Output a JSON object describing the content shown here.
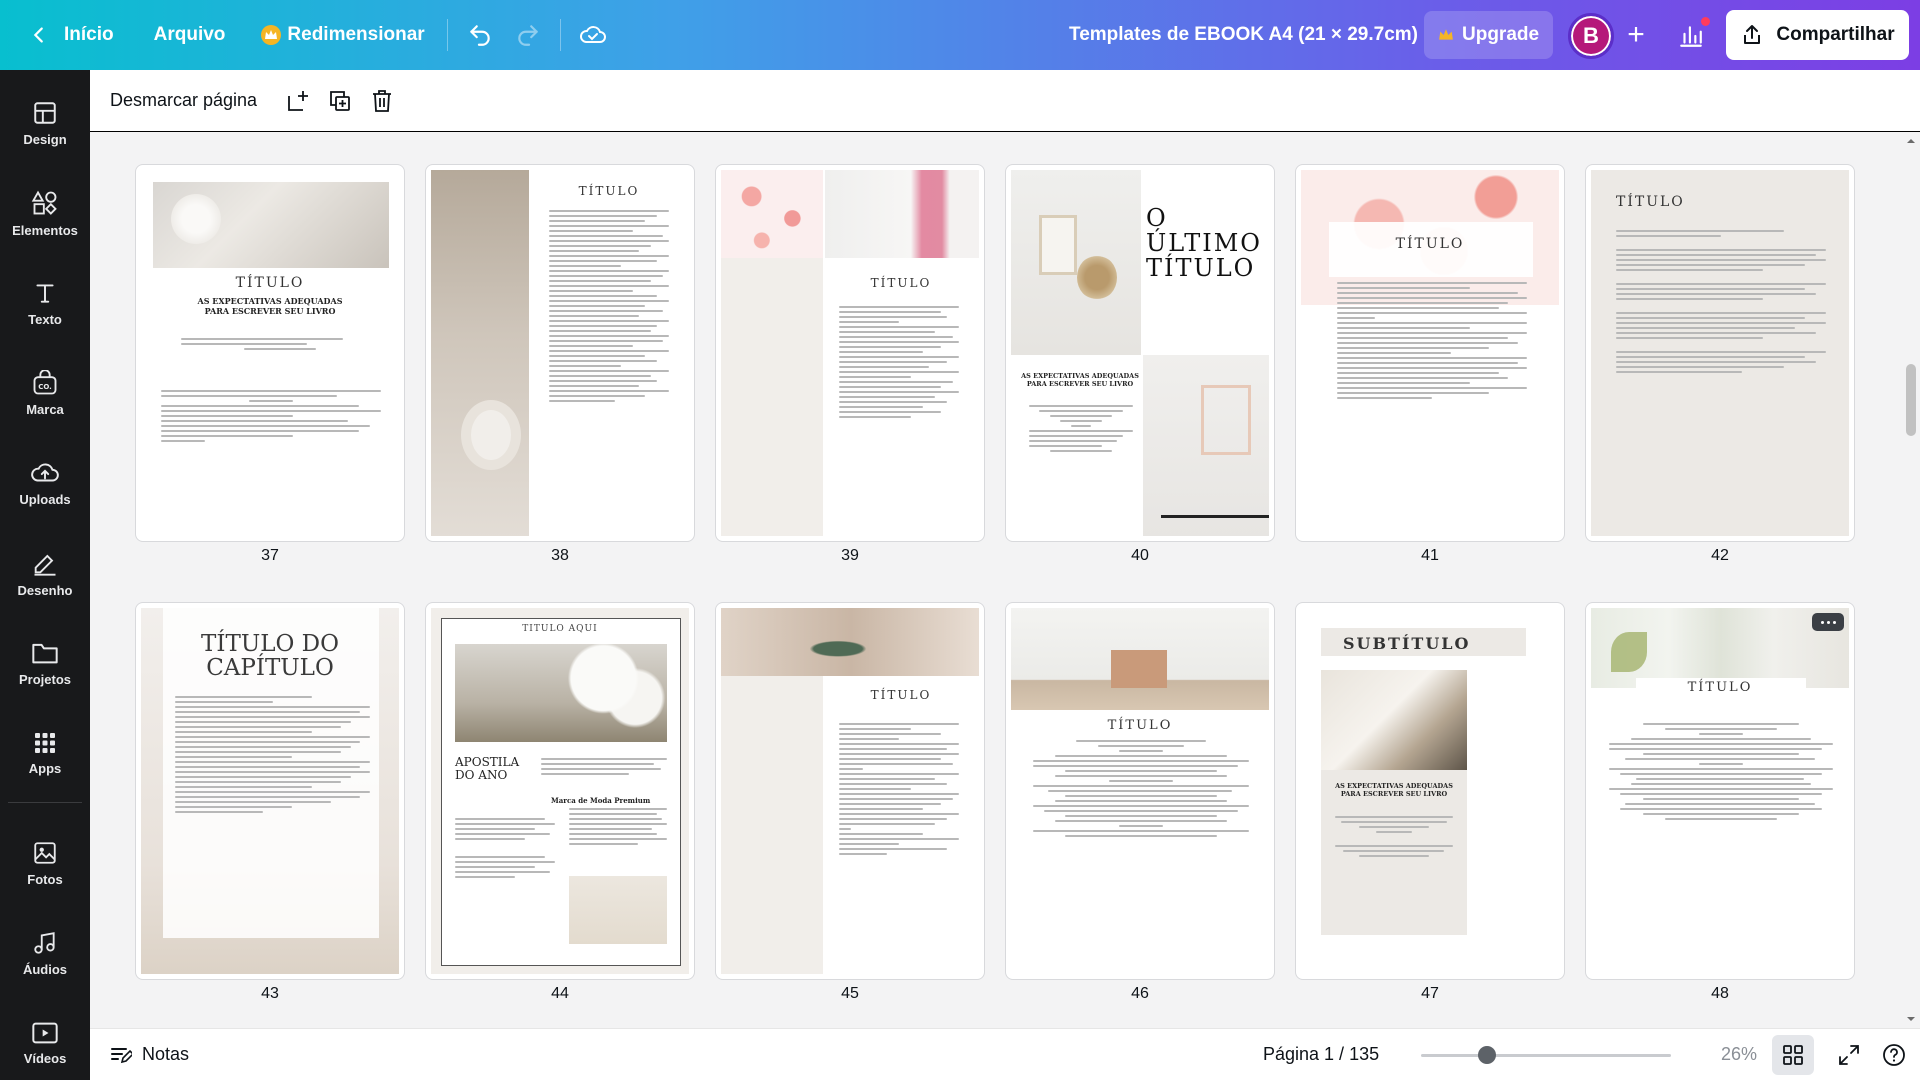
{
  "topbar": {
    "home_label": "Início",
    "file_label": "Arquivo",
    "resize_label": "Redimensionar",
    "doc_title": "Templates de EBOOK A4 (21 × 29.7cm)",
    "upgrade_label": "Upgrade",
    "avatar_initial": "B",
    "share_label": "Compartilhar",
    "accent_gradient": [
      "#08bfcf",
      "#7c3ee4"
    ]
  },
  "sidebar": {
    "items": [
      {
        "label": "Design",
        "icon": "layout-icon"
      },
      {
        "label": "Elementos",
        "icon": "shapes-icon"
      },
      {
        "label": "Texto",
        "icon": "text-icon"
      },
      {
        "label": "Marca",
        "icon": "brand-icon"
      },
      {
        "label": "Uploads",
        "icon": "cloud-upload-icon"
      },
      {
        "label": "Desenho",
        "icon": "pen-icon"
      },
      {
        "label": "Projetos",
        "icon": "folder-icon"
      },
      {
        "label": "Apps",
        "icon": "apps-grid-icon"
      },
      {
        "label": "Fotos",
        "icon": "photo-icon"
      },
      {
        "label": "Áudios",
        "icon": "music-icon"
      },
      {
        "label": "Vídeos",
        "icon": "video-icon"
      }
    ]
  },
  "subtoolbar": {
    "deselect_label": "Desmarcar página"
  },
  "pages": [
    {
      "number": "37",
      "title": "TÍTULO",
      "subtitle": "AS EXPECTATIVAS ADEQUADAS PARA ESCREVER SEU LIVRO"
    },
    {
      "number": "38",
      "title": "TÍTULO"
    },
    {
      "number": "39",
      "title": "TÍTULO"
    },
    {
      "number": "40",
      "title": "O ÚLTIMO TÍTULO",
      "subtitle": "AS EXPECTATIVAS ADEQUADAS PARA ESCREVER SEU LIVRO"
    },
    {
      "number": "41",
      "title": "TÍTULO"
    },
    {
      "number": "42",
      "title": "TÍTULO"
    },
    {
      "number": "43",
      "title": "TÍTULO DO CAPÍTULO"
    },
    {
      "number": "44",
      "title": "TITULO AQUI",
      "side_title": "APOSTILA DO ANO",
      "brand": "Marca de Moda Premium"
    },
    {
      "number": "45",
      "title": "TÍTULO"
    },
    {
      "number": "46",
      "title": "TÍTULO"
    },
    {
      "number": "47",
      "title": "SUBTÍTULO",
      "subtitle": "AS EXPECTATIVAS ADEQUADAS PARA ESCREVER SEU LIVRO"
    },
    {
      "number": "48",
      "title": "TÍTULO"
    }
  ],
  "bottombar": {
    "notes_label": "Notas",
    "page_info": "Página 1 / 135",
    "zoom_label": "26%",
    "zoom_level": 0.26
  }
}
